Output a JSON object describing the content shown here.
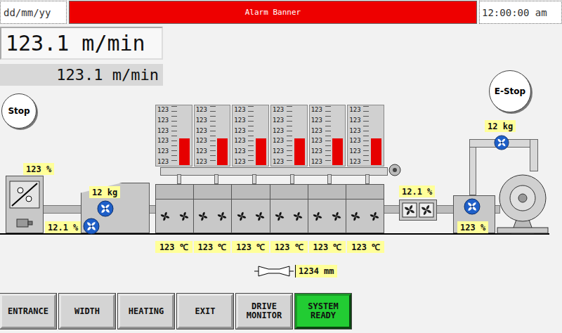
{
  "header": {
    "date": "dd/mm/yy",
    "alarm": "Alarm Banner",
    "time": "12:00:00 am"
  },
  "speed": {
    "actual": "123.1 m/min",
    "setpoint": "123.1 m/min"
  },
  "controls": {
    "stop": "Stop",
    "estop": "E-Stop"
  },
  "readings": {
    "entrance_percent": "123 %",
    "entrance_moisture": "12.1 %",
    "feeder_weight": "12 kg",
    "cooler_moisture": "12.1 %",
    "exit_percent": "123 %",
    "winder_weight": "12 kg"
  },
  "zones": [
    {
      "temperature": "123 ℃",
      "scale": [
        "123",
        "123",
        "123",
        "123",
        "123",
        "123"
      ],
      "level": 0.45
    },
    {
      "temperature": "123 ℃",
      "scale": [
        "123",
        "123",
        "123",
        "123",
        "123",
        "123"
      ],
      "level": 0.45
    },
    {
      "temperature": "123 ℃",
      "scale": [
        "123",
        "123",
        "123",
        "123",
        "123",
        "123"
      ],
      "level": 0.45
    },
    {
      "temperature": "123 ℃",
      "scale": [
        "123",
        "123",
        "123",
        "123",
        "123",
        "123"
      ],
      "level": 0.45
    },
    {
      "temperature": "123 ℃",
      "scale": [
        "123",
        "123",
        "123",
        "123",
        "123",
        "123"
      ],
      "level": 0.45
    },
    {
      "temperature": "123 ℃",
      "scale": [
        "123",
        "123",
        "123",
        "123",
        "123",
        "123"
      ],
      "level": 0.45
    }
  ],
  "width": "1234 mm",
  "buttons": [
    {
      "label": "ENTRANCE",
      "on": false
    },
    {
      "label": "WIDTH",
      "on": false
    },
    {
      "label": "HEATING",
      "on": false
    },
    {
      "label": "EXIT",
      "on": false
    },
    {
      "label": "DRIVE MONITOR",
      "on": false
    },
    {
      "label": "SYSTEM READY",
      "on": true
    }
  ]
}
